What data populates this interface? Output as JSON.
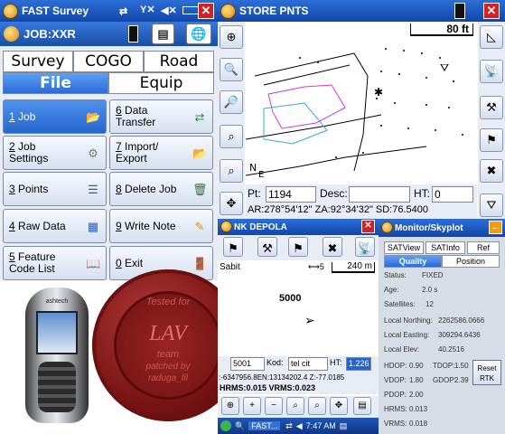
{
  "w1": {
    "title": "FAST Survey",
    "job_label": "JOB:XXR",
    "tabs": [
      "Survey",
      "COGO",
      "Road",
      "File",
      "Equip"
    ],
    "menu": [
      {
        "num": "1",
        "text": "Job"
      },
      {
        "num": "6",
        "text": "Data Transfer"
      },
      {
        "num": "2",
        "text": "Job Settings"
      },
      {
        "num": "7",
        "text": "Import/ Export"
      },
      {
        "num": "3",
        "text": "Points"
      },
      {
        "num": "8",
        "text": "Delete Job"
      },
      {
        "num": "4",
        "text": "Raw Data"
      },
      {
        "num": "9",
        "text": "Write Note"
      },
      {
        "num": "5",
        "text": "Feature Code List"
      },
      {
        "num": "0",
        "text": "Exit"
      }
    ]
  },
  "w2": {
    "title": "STORE PNTS",
    "scale": "80 ft",
    "pt_label": "Pt:",
    "pt_value": "1194",
    "desc_label": "Desc:",
    "ht_label": "HT:",
    "ht_value": "0",
    "status_line": "AR:278°54'12\" ZA:92°34'32\"  SD:76.5400"
  },
  "w3": {
    "title": "NK DEPOLA",
    "sabit": "Sabit",
    "scale_mid": "5",
    "scale_right": "240 m",
    "point_label": "5000",
    "pt_value": "5001",
    "kod_label": "Kod:",
    "kod_value": "tel cit",
    "ht_label": "HT:",
    "ht_value": "1.226",
    "coords": ":-6347956.8EN:13134202.4 Z:-77.0185",
    "accuracy": "HRMS:0.015 VRMS:0.023"
  },
  "taskbar": {
    "app": "FAST...",
    "time": "7:47 AM"
  },
  "w4": {
    "title": "Monitor/Skyplot",
    "tabs1": [
      "SATView",
      "SATInfo",
      "Ref"
    ],
    "tabs2": [
      "Quality",
      "Position"
    ],
    "rows": [
      {
        "k": "Status:",
        "v": "FIXED"
      },
      {
        "k": "Age:",
        "v": "2.0 s"
      },
      {
        "k": "Satellites:",
        "v": "12"
      },
      {
        "k": "Local Northing:",
        "v": "2262586.0666"
      },
      {
        "k": "Local Easting:",
        "v": "309294.6436"
      },
      {
        "k": "Local Elev:",
        "v": "40.2516"
      }
    ],
    "dops": [
      {
        "k": "HDOP:",
        "v": "0.90",
        "k2": "TDOP:",
        "v2": "1.50"
      },
      {
        "k": "VDOP:",
        "v": "1.80",
        "k2": "GDOP:",
        "v2": "2.39"
      },
      {
        "k": "PDOP:",
        "v": "2.00",
        "k2": "",
        "v2": ""
      },
      {
        "k": "HRMS:",
        "v": "0.013",
        "k2": "",
        "v2": ""
      },
      {
        "k": "VRMS:",
        "v": "0.018",
        "k2": "",
        "v2": ""
      }
    ],
    "reset": "Reset RTK"
  },
  "device_brand": "ashtech",
  "seal_text": {
    "top": "Tested for",
    "center": "LAV",
    "mid": "team",
    "bottom": "patched by",
    "name": "raduga_fil"
  }
}
